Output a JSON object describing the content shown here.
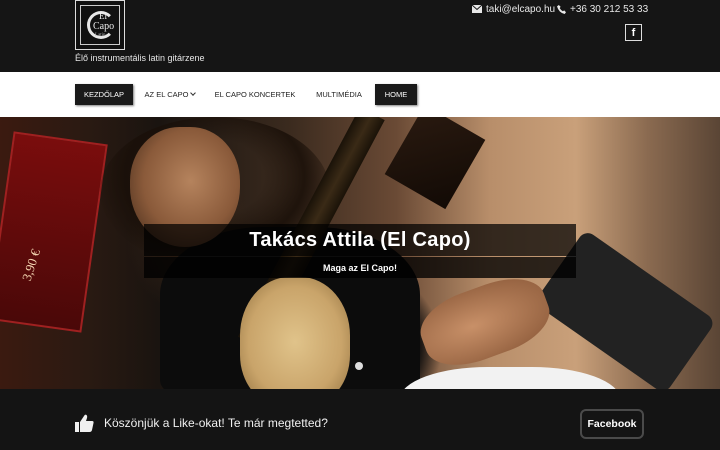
{
  "header": {
    "logo": {
      "line1": "El",
      "line2": "Capo",
      "line3": "Latin"
    },
    "tagline": "Élő instrumentális latin gitárzene",
    "email": "taki@elcapo.hu",
    "phone": "+36 30 212 53 33",
    "social_icon": "facebook-icon",
    "social_label": "f"
  },
  "nav": {
    "items": [
      {
        "label": "KEZDŐLAP",
        "active": true
      },
      {
        "label": "AZ EL CAPO",
        "has_dropdown": true
      },
      {
        "label": "EL CAPO KONCERTEK"
      },
      {
        "label": "MULTIMÉDIA"
      },
      {
        "label": "HOME",
        "active": true
      }
    ]
  },
  "hero": {
    "title": "Takács Attila (El Capo)",
    "subtitle": "Maga az El Capo!",
    "sign_text": "3,90 €"
  },
  "footer_bar": {
    "like_icon": "thumbs-up-icon",
    "text": "Köszönjük a Like-okat! Te már megtetted?",
    "button_label": "Facebook"
  }
}
